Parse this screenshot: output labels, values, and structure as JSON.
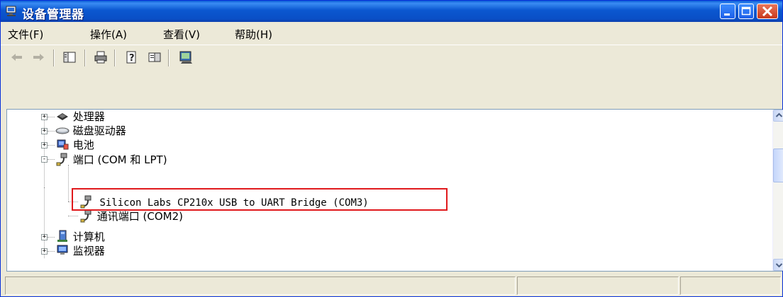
{
  "window": {
    "title": "设备管理器",
    "accent": "#0a4fc6",
    "buttons": [
      "minimize-icon",
      "maximize-icon",
      "close-icon"
    ]
  },
  "menu": [
    "文件(F)",
    "操作(A)",
    "查看(V)",
    "帮助(H)"
  ],
  "toolbar": {
    "icons": [
      "back-arrow-icon",
      "forward-arrow-icon",
      "show-hide-tree-icon",
      "print-icon",
      "help-icon",
      "properties-icon",
      "scan-hardware-icon"
    ]
  },
  "tree": {
    "items": [
      {
        "label": "处理器",
        "icon": "processor-icon",
        "expander": "+"
      },
      {
        "label": "磁盘驱动器",
        "icon": "disk-drive-icon",
        "expander": "+"
      },
      {
        "label": "电池",
        "icon": "battery-icon",
        "expander": "+"
      },
      {
        "label": "端口 (COM 和 LPT)",
        "icon": "port-connector-icon",
        "expander": "-"
      },
      {
        "label": "Silicon Labs CP210x USB to UART Bridge (COM3)",
        "icon": "port-connector-icon",
        "expander": ""
      },
      {
        "label": "通讯端口 (COM2)",
        "icon": "port-connector-icon",
        "expander": ""
      },
      {
        "label": "计算机",
        "icon": "computer-icon",
        "expander": "+"
      },
      {
        "label": "监视器",
        "icon": "monitor-icon",
        "expander": "+"
      }
    ]
  },
  "highlight": {
    "color": "#e0191c"
  }
}
